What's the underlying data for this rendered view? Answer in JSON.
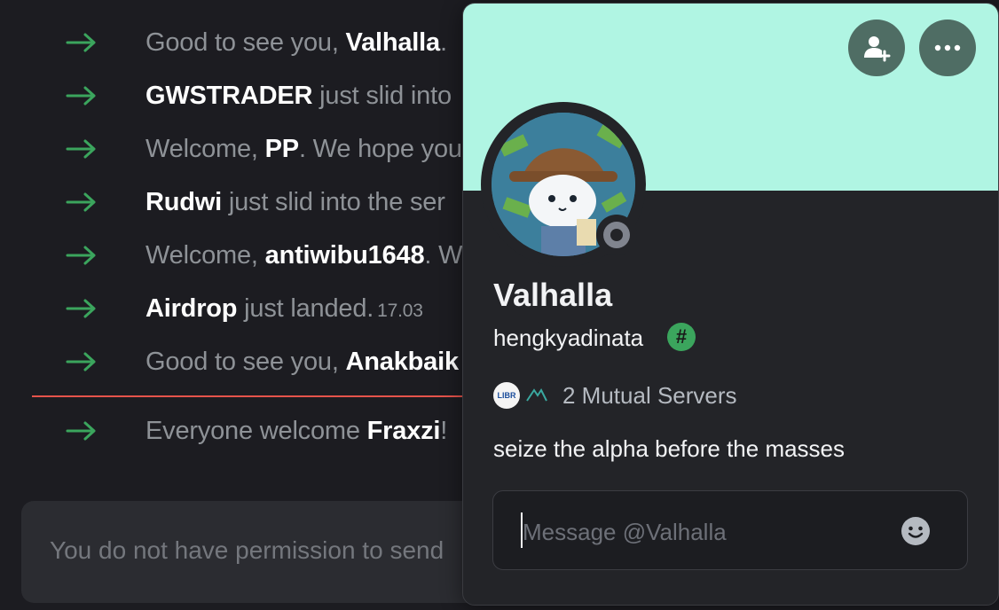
{
  "colors": {
    "accent_banner": "#b0f5e3",
    "arrow_green": "#3ba55d",
    "divider_red": "#e5534b",
    "background": "#1c1c21"
  },
  "chat": {
    "messages": [
      {
        "icon": "join-arrow-icon",
        "pre": "Good to see you, ",
        "name": "Valhalla",
        "post": ".",
        "time": ""
      },
      {
        "icon": "join-arrow-icon",
        "pre": "",
        "name": "GWSTRADER",
        "post": " just slid into",
        "time": ""
      },
      {
        "icon": "join-arrow-icon",
        "pre": "Welcome, ",
        "name": "PP",
        "post": ". We hope you",
        "time": ""
      },
      {
        "icon": "join-arrow-icon",
        "pre": "",
        "name": "Rudwi",
        "post": " just slid into the ser",
        "time": ""
      },
      {
        "icon": "join-arrow-icon",
        "pre": "Welcome, ",
        "name": "antiwibu1648",
        "post": ". W",
        "time": ""
      },
      {
        "icon": "join-arrow-icon",
        "pre": "",
        "name": "Airdrop",
        "post": " just landed.",
        "time": "17.03"
      },
      {
        "icon": "join-arrow-icon",
        "pre": "Good to see you, ",
        "name": "Anakbaik",
        "post": "",
        "time": ""
      },
      {
        "icon": "join-arrow-icon",
        "pre": "Everyone welcome ",
        "name": "Fraxzi",
        "post": "!",
        "time": ""
      }
    ],
    "permission_text": "You do not have permission to send"
  },
  "profile": {
    "display_name": "Valhalla",
    "username": "hengkyadinata",
    "badge_symbol": "#",
    "mutual_servers": "2 Mutual Servers",
    "server_icon_1_text": "LIBR",
    "bio": "seize the alpha before the masses",
    "message_placeholder": "Message @Valhalla",
    "buttons": {
      "add_friend_icon": "add-friend-icon",
      "more_icon": "more-options-icon"
    },
    "status": "offline"
  }
}
